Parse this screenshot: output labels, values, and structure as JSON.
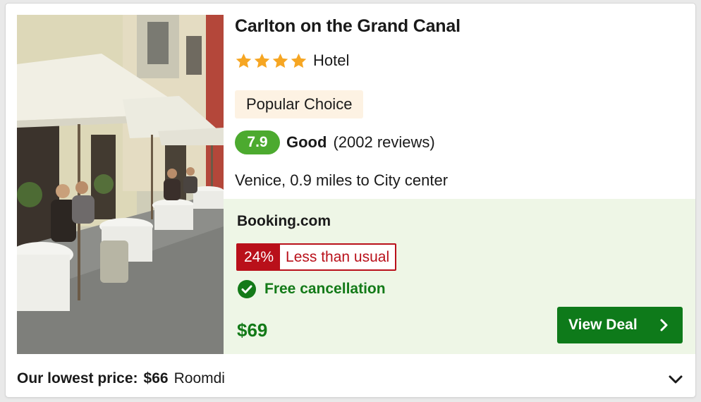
{
  "hotel": {
    "name": "Carlton on the Grand Canal",
    "stars": 4,
    "type": "Hotel",
    "badge": "Popular Choice",
    "score": "7.9",
    "rating_word": "Good",
    "reviews": "(2002 reviews)",
    "location": "Venice, 0.9 miles to City center"
  },
  "deal": {
    "provider": "Booking.com",
    "discount_pct": "24%",
    "discount_text": "Less than usual",
    "cancellation": "Free cancellation",
    "price": "$69",
    "button_label": "View Deal"
  },
  "lowest": {
    "label": "Our lowest price:",
    "price": "$66",
    "provider": "Roomdi"
  },
  "colors": {
    "star": "#f6a623",
    "score_badge": "#4caa2f",
    "discount_red": "#b9101a",
    "deal_green": "#137a18",
    "button_green": "#0e7a1a",
    "deal_bg": "#eef6e6",
    "popular_bg": "#fdf2e3"
  },
  "icons": {
    "star": "star-icon",
    "check": "check-circle-icon",
    "chevron_right": "chevron-right-icon",
    "chevron_down": "chevron-down-icon"
  }
}
